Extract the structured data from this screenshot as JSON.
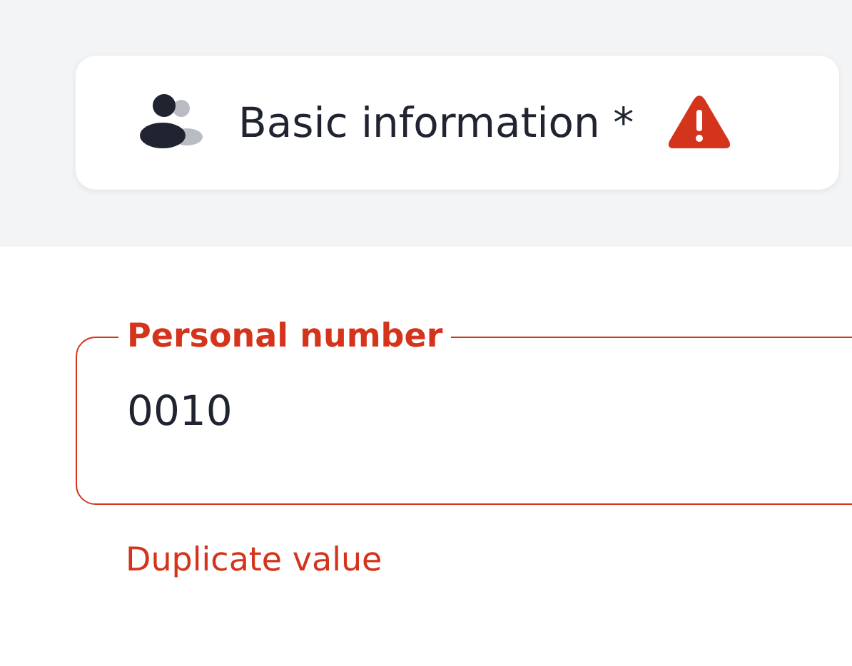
{
  "tab": {
    "label": "Basic information *",
    "error": true
  },
  "field": {
    "label": "Personal number",
    "value": "0010",
    "error": true,
    "helper_text": "Duplicate value"
  }
}
